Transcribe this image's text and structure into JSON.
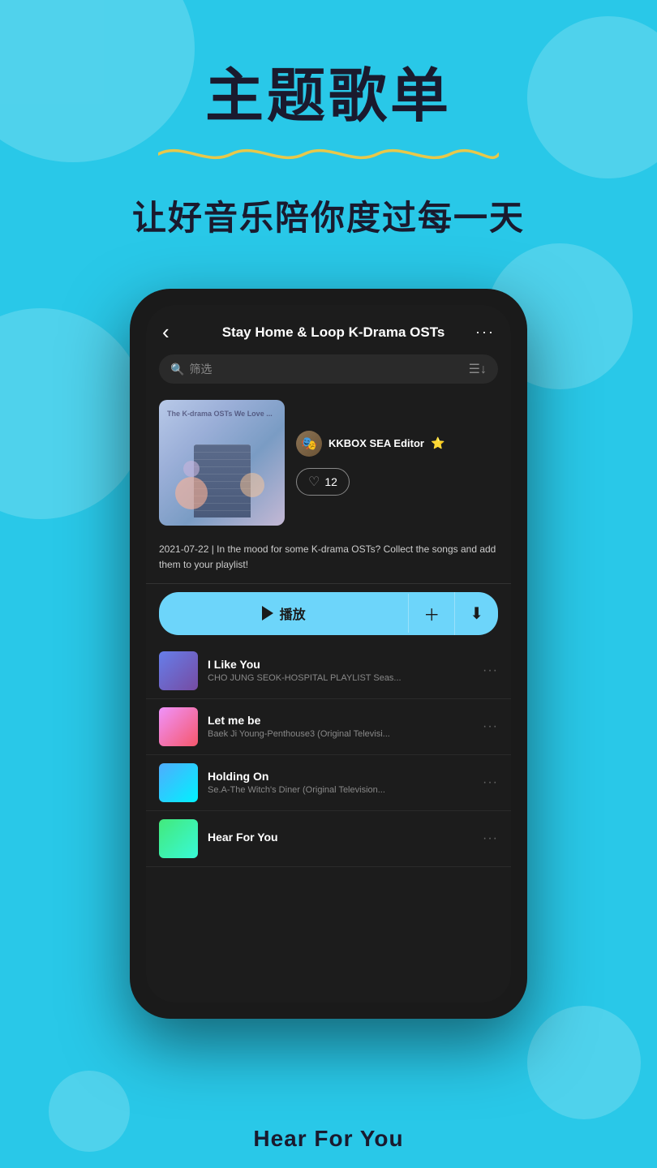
{
  "background_color": "#29c8e8",
  "header": {
    "main_title": "主题歌单",
    "subtitle": "让好音乐陪你度过每一天"
  },
  "phone": {
    "top_bar": {
      "playlist_title": "Stay Home & Loop K-Drama OSTs",
      "more_label": "···"
    },
    "search": {
      "placeholder": "筛选"
    },
    "playlist": {
      "editor_name": "KKBOX SEA Editor",
      "like_count": "12",
      "description": "2021-07-22 | In the mood for some K-drama OSTs? Collect the songs and add them to your playlist!",
      "play_label": "播放",
      "album_art_text": "The K-drama OSTs We Love ..."
    },
    "songs": [
      {
        "name": "I Like You",
        "artist": "CHO JUNG SEOK-HOSPITAL PLAYLIST Seas...",
        "thumb_class": "song-thumb-1"
      },
      {
        "name": "Let me be",
        "artist": "Baek Ji Young-Penthouse3 (Original Televisi...",
        "thumb_class": "song-thumb-2"
      },
      {
        "name": "Holding On",
        "artist": "Se.A-The Witch's Diner (Original Television...",
        "thumb_class": "song-thumb-3"
      },
      {
        "name": "Hear For You",
        "artist": "",
        "thumb_class": "song-thumb-4"
      }
    ]
  },
  "bottom_label": "Hear For You"
}
